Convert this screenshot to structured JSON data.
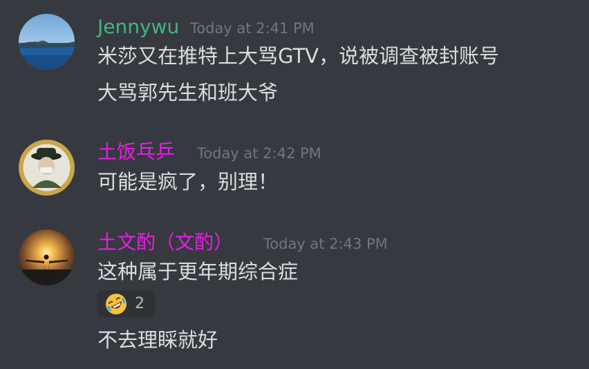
{
  "messages": [
    {
      "author": "Jennywu",
      "author_color": "#43b581",
      "timestamp": "Today at 2:41 PM",
      "avatar": "lake-island-photo",
      "lines": [
        "米莎又在推特上大骂GTV，说被调查被封账号",
        "大骂郭先生和班大爷"
      ]
    },
    {
      "author": "土饭乓乒",
      "author_color": "#e91ee8",
      "timestamp": "Today at 2:42 PM",
      "avatar": "masked-figure-hat-photo",
      "lines": [
        "可能是疯了，别理！"
      ]
    },
    {
      "author": "土文酌（文酌）",
      "author_color": "#e91ee8",
      "timestamp": "Today at 2:43 PM",
      "avatar": "sunset-silhouette-photo",
      "lines": [
        "这种属于更年期综合症",
        "不去理睬就好"
      ],
      "reaction": {
        "emoji": "rolling-on-floor-laughing-icon",
        "count": "2"
      }
    }
  ],
  "colors": {
    "background": "#36393f",
    "text": "#dcddde",
    "timestamp": "#72767d",
    "reaction_bg": "#2f3136"
  }
}
